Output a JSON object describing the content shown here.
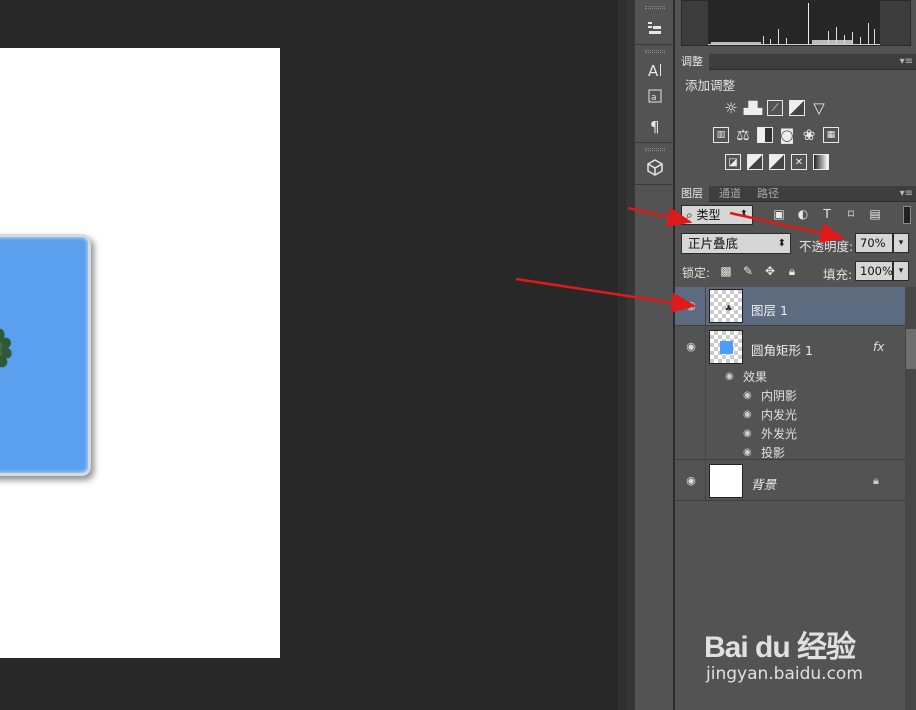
{
  "panels": {
    "adjustments": {
      "tab_label": "调整",
      "title": "添加调整"
    },
    "layers": {
      "tabs": [
        "图层",
        "通道",
        "路径"
      ],
      "filter_kind": "类型",
      "blend_mode": "正片叠底",
      "opacity_label": "不透明度:",
      "opacity_value": "70%",
      "lock_label": "锁定:",
      "fill_label": "填充:",
      "fill_value": "100%",
      "items": [
        {
          "name": "图层 1",
          "selected": true
        },
        {
          "name": "圆角矩形 1",
          "fx": "fx"
        },
        {
          "name": "背景",
          "locked": true
        }
      ],
      "effects_label": "效果",
      "effects": [
        "内阴影",
        "内发光",
        "外发光",
        "投影"
      ]
    }
  },
  "watermark": {
    "logo": "Bai du 经验",
    "url": "jingyan.baidu.com"
  },
  "colors": {
    "arrow": "#e01a1a",
    "shape_fill": "#5aa0ef",
    "selected_layer": "#5d6b80"
  },
  "icons": [
    "eye-icon",
    "lock-icon",
    "search-icon",
    "menu-icon"
  ]
}
